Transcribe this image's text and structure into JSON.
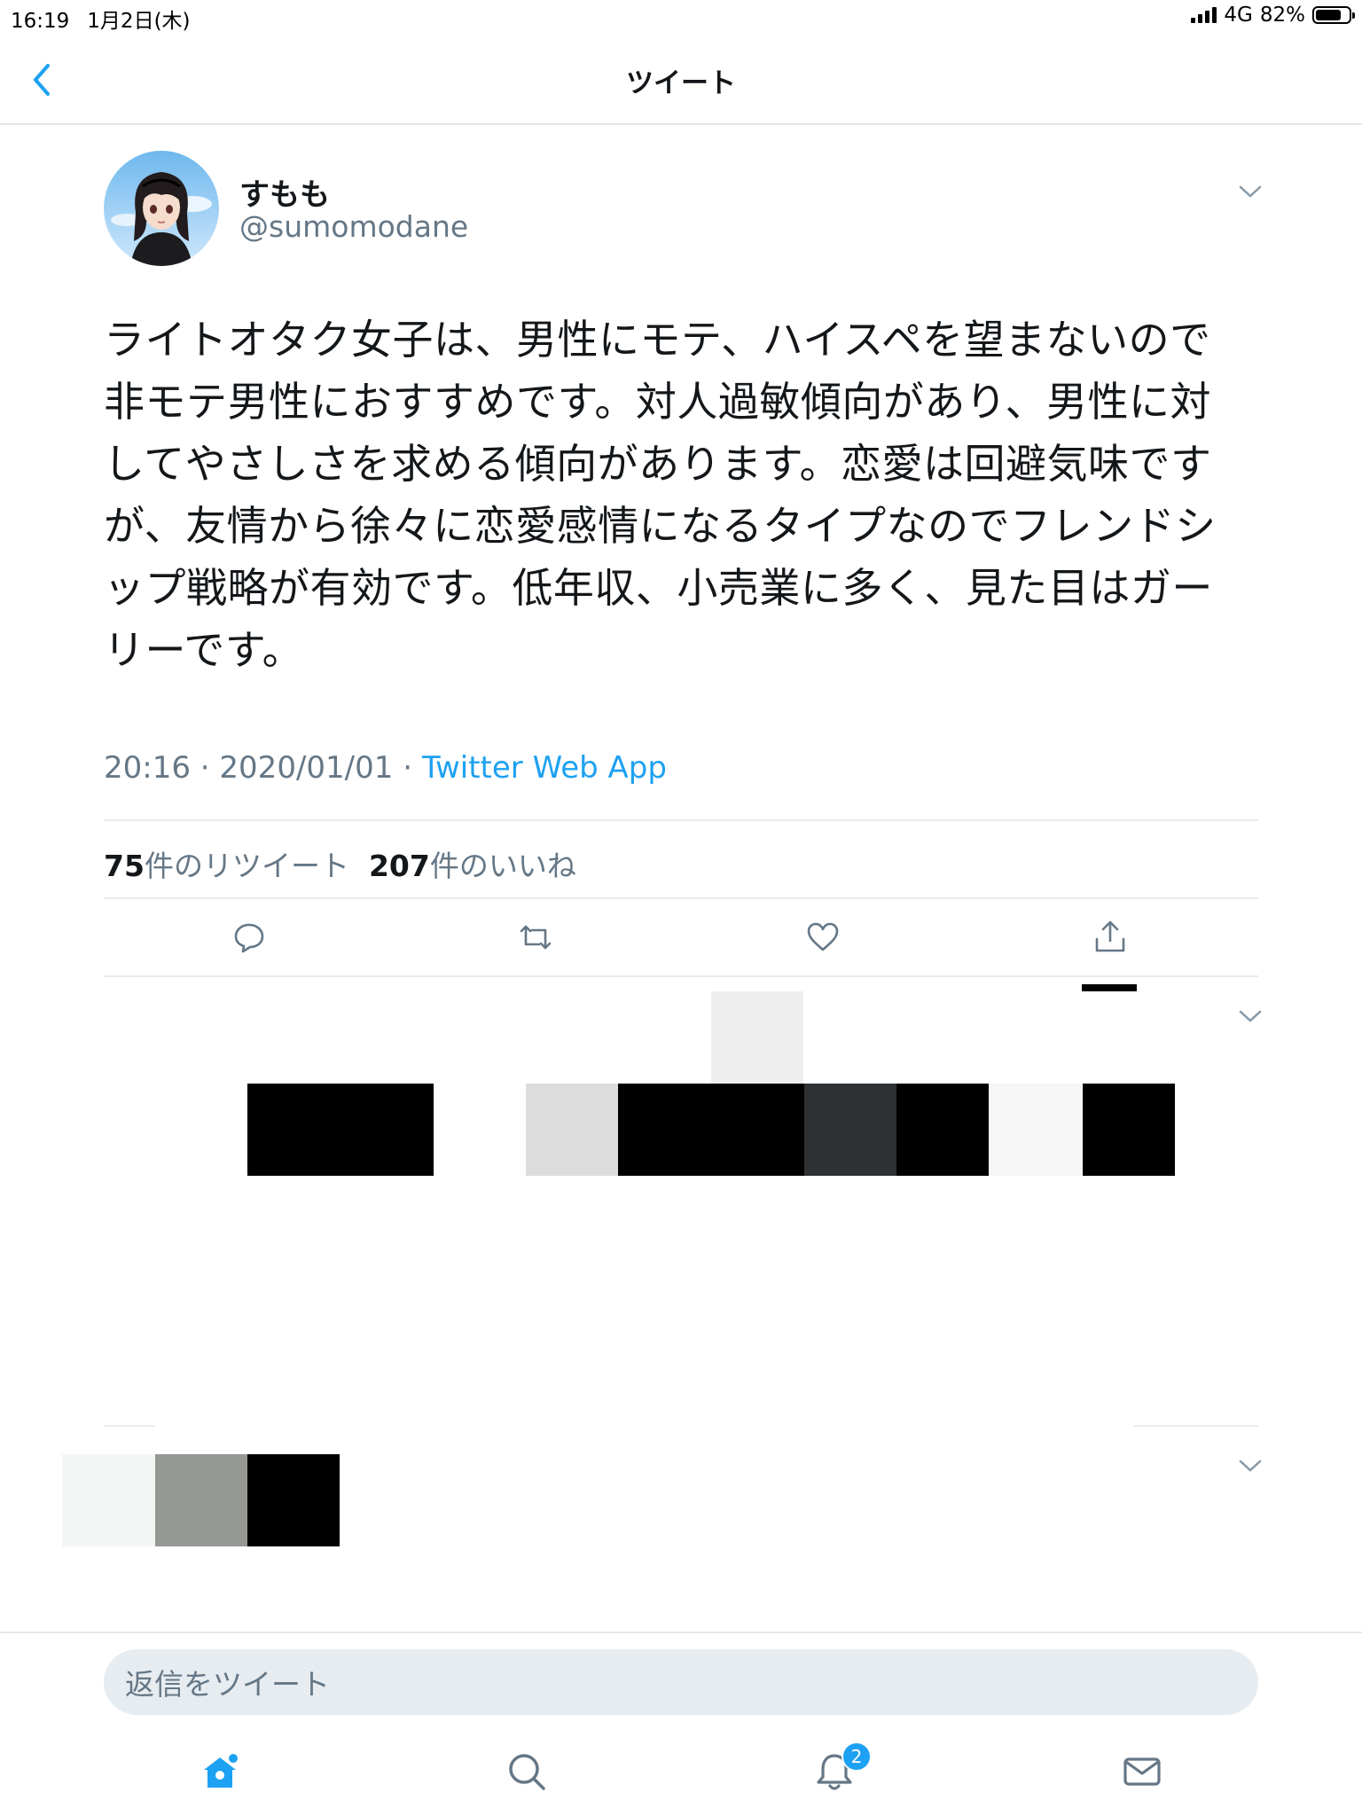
{
  "status_bar": {
    "time": "16:19",
    "date": "1月2日(木)",
    "network": "4G",
    "battery": "82%",
    "battery_level": 0.82
  },
  "nav": {
    "title": "ツイート",
    "back_icon": "chevron-left-icon"
  },
  "tweet": {
    "display_name": "すもも",
    "handle": "@sumomodane",
    "lines": [
      "ライトオタク女子は、男性にモテ、ハイスペを望まないので",
      "非モテ男性におすすめです。対人過敏傾向があり、男性に対",
      "してやさしさを求める傾向があります。恋愛は回避気味です",
      "が、友情から徐々に恋愛感情になるタイプなのでフレンドシ",
      "ップ戦略が有効です。低年収、小売業に多く、見た目はガー",
      "リーです。"
    ],
    "time": "20:16",
    "date": "2020/01/01",
    "separator": "·",
    "source": "Twitter Web App",
    "retweet_count": "75",
    "retweet_label": "件のリツイート",
    "like_count": "207",
    "like_label": "件のいいね"
  },
  "actions": [
    "reply-icon",
    "retweet-icon",
    "like-icon",
    "share-icon"
  ],
  "reply": {
    "placeholder": "返信をツイート"
  },
  "tab_bar": {
    "tabs": [
      "home-icon",
      "search-icon",
      "notifications-icon",
      "messages-icon"
    ],
    "notification_badge": "2"
  },
  "colors": {
    "accent": "#1da1f2",
    "secondary_text": "#657786",
    "primary_text": "#14171a",
    "divider": "#e6ecf0"
  }
}
